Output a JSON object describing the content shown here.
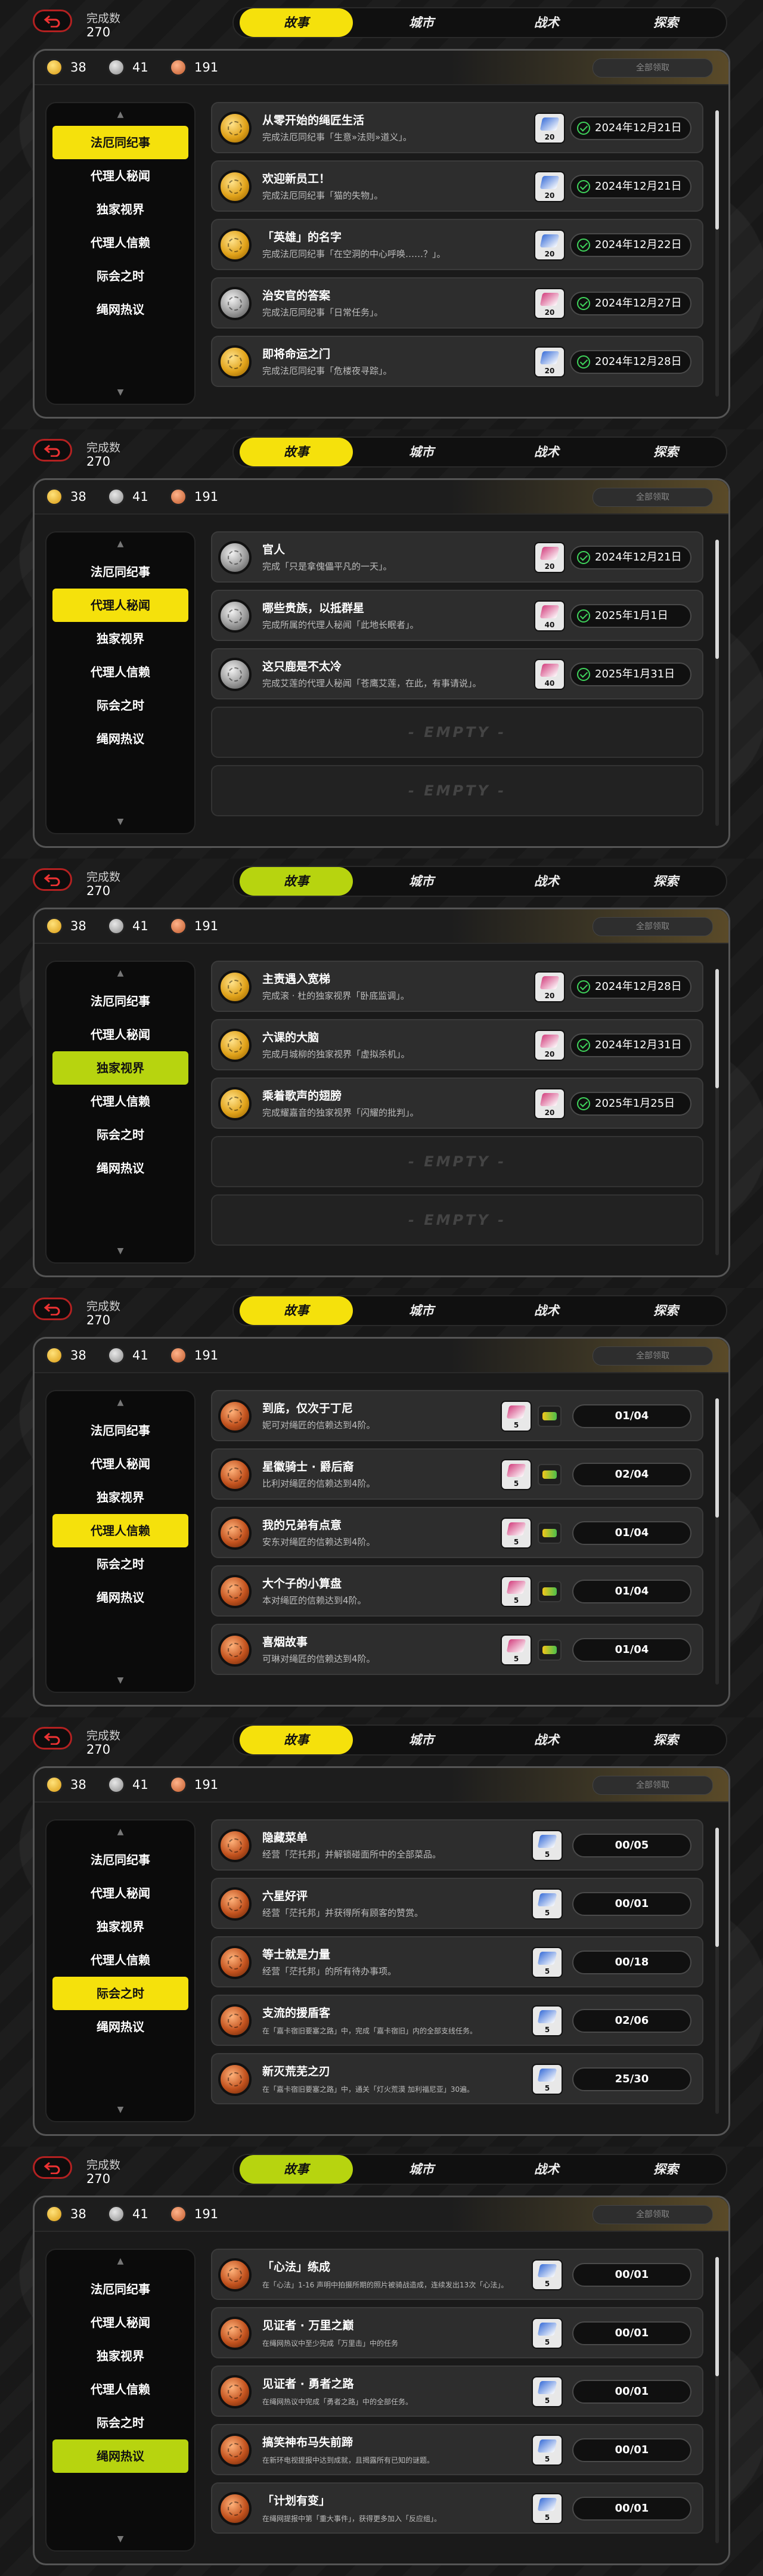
{
  "header": {
    "done_label": "完成数",
    "done_count": "270",
    "tabs": [
      "故事",
      "城市",
      "战术",
      "探索"
    ]
  },
  "currency": {
    "gold": "38",
    "silver": "41",
    "copper": "191"
  },
  "claim_all_label": "全部领取",
  "sidebar_items": [
    "法厄同纪事",
    "代理人秘闻",
    "独家视界",
    "代理人信赖",
    "际会之时",
    "绳网热议"
  ],
  "empty_label": "- EMPTY -",
  "colors": {
    "accent": "#f5e10c",
    "accent_variant": "#b7d40f",
    "check": "#3fd35b",
    "frame": "#555555"
  },
  "panels": [
    {
      "tab_accent": "#f5e10c",
      "active_side": 0,
      "rows": [
        {
          "medal": "gold",
          "title": "从零开始的绳匠生活",
          "desc": "完成法厄同纪事「生意»法则»道义」。",
          "reward_color": "#3b6fd8",
          "qty": "20",
          "kind": "date",
          "value": "2024年12月21日"
        },
        {
          "medal": "gold",
          "title": "欢迎新员工！",
          "desc": "完成法厄同纪事「猫的失物」。",
          "reward_color": "#3b6fd8",
          "qty": "20",
          "kind": "date",
          "value": "2024年12月21日"
        },
        {
          "medal": "gold",
          "title": "「英雄」的名字",
          "desc": "完成法厄同纪事「在空洞的中心呼唤……？」。",
          "reward_color": "#3b6fd8",
          "qty": "20",
          "kind": "date",
          "value": "2024年12月22日"
        },
        {
          "medal": "silver",
          "title": "治安官的答案",
          "desc": "完成法厄同纪事「日常任务」。",
          "reward_color": "#d3417f",
          "qty": "20",
          "kind": "date",
          "value": "2024年12月27日"
        },
        {
          "medal": "gold",
          "title": "即将命运之门",
          "desc": "完成法厄同纪事「危楼夜寻踪」。",
          "reward_color": "#3b6fd8",
          "qty": "20",
          "kind": "date",
          "value": "2024年12月28日"
        }
      ]
    },
    {
      "tab_accent": "#f5e10c",
      "active_side": 1,
      "rows": [
        {
          "medal": "silver",
          "title": "官人",
          "desc": "完成「只是拿傀儡平凡的一天」。",
          "reward_color": "#d3417f",
          "qty": "20",
          "kind": "date",
          "value": "2024年12月21日"
        },
        {
          "medal": "silver",
          "title": "哪些贵族，以抵群星",
          "desc": "完成所属的代理人秘闻「此地长眠者」。",
          "reward_color": "#d3417f",
          "qty": "40",
          "kind": "date",
          "value": "2025年1月1日"
        },
        {
          "medal": "silver",
          "title": "这只鹿是不太冷",
          "desc": "完成艾莲的代理人秘闻「苍鹰艾莲，在此，有事请说」。",
          "reward_color": "#d3417f",
          "qty": "40",
          "kind": "date",
          "value": "2025年1月31日"
        },
        {
          "empty": true
        },
        {
          "empty": true
        }
      ]
    },
    {
      "tab_accent": "#b7d40f",
      "active_side": 2,
      "rows": [
        {
          "medal": "gold",
          "title": "主责遇入宽梯",
          "desc": "完成滚 · 杜的独家视界「卧底监调」。",
          "reward_color": "#d3417f",
          "qty": "20",
          "kind": "date",
          "value": "2024年12月28日"
        },
        {
          "medal": "gold",
          "title": "六课的大脑",
          "desc": "完成月城柳的独家视界「虚拟杀机」。",
          "reward_color": "#d3417f",
          "qty": "20",
          "kind": "date",
          "value": "2024年12月31日"
        },
        {
          "medal": "gold",
          "title": "乘着歌声的翅膀",
          "desc": "完成耀嘉音的独家视界「闪耀的批判」。",
          "reward_color": "#d3417f",
          "qty": "20",
          "kind": "date",
          "value": "2025年1月25日"
        },
        {
          "empty": true
        },
        {
          "empty": true
        }
      ]
    },
    {
      "tab_accent": "#f5e10c",
      "active_side": 3,
      "rows": [
        {
          "medal": "bronze",
          "title": "到底，仅次于丁尼",
          "desc": "妮可对绳匠的信赖达到4阶。",
          "reward_color": "#d3417f",
          "qty": "5",
          "kind": "prog2",
          "value": "01/04"
        },
        {
          "medal": "bronze",
          "title": "星徽骑士 · 爵后裔",
          "desc": "比利对绳匠的信赖达到4阶。",
          "reward_color": "#d3417f",
          "qty": "5",
          "kind": "prog2",
          "value": "02/04"
        },
        {
          "medal": "bronze",
          "title": "我的兄弟有点意",
          "desc": "安东对绳匠的信赖达到4阶。",
          "reward_color": "#d3417f",
          "qty": "5",
          "kind": "prog2",
          "value": "01/04"
        },
        {
          "medal": "bronze",
          "title": "大个子的小算盘",
          "desc": "本对绳匠的信赖达到4阶。",
          "reward_color": "#d3417f",
          "qty": "5",
          "kind": "prog2",
          "value": "01/04"
        },
        {
          "medal": "bronze",
          "title": "喜烟故事",
          "desc": "可琳对绳匠的信赖达到4阶。",
          "reward_color": "#d3417f",
          "qty": "5",
          "kind": "prog2",
          "value": "01/04"
        }
      ]
    },
    {
      "tab_accent": "#f5e10c",
      "active_side": 4,
      "rows": [
        {
          "medal": "bronze",
          "title": "隐藏菜单",
          "desc": "经营「茫托邦」并解锁碰面所中的全部菜品。",
          "reward_color": "#3b6fd8",
          "qty": "5",
          "kind": "prog",
          "value": "00/05"
        },
        {
          "medal": "bronze",
          "title": "六星好评",
          "desc": "经营「茫托邦」并获得所有顾客的赞赏。",
          "reward_color": "#3b6fd8",
          "qty": "5",
          "kind": "prog",
          "value": "00/01"
        },
        {
          "medal": "bronze",
          "title": "等士就是力量",
          "desc": "经营「茫托邦」的所有待办事项。",
          "reward_color": "#3b6fd8",
          "qty": "5",
          "kind": "prog",
          "value": "00/18"
        },
        {
          "medal": "bronze",
          "title": "支流的援盾客",
          "desc": "在「嘉卡宿旧要塞之路」中，完成「嘉卡宿旧」内的全部支线任务。",
          "reward_color": "#3b6fd8",
          "qty": "5",
          "kind": "prog",
          "value": "02/06",
          "small": true
        },
        {
          "medal": "bronze",
          "title": "新灭荒芜之刃",
          "desc": "在「嘉卡宿旧要塞之路」中，通关「灯火荒漠 加利福尼亚」30遍。",
          "reward_color": "#3b6fd8",
          "qty": "5",
          "kind": "prog",
          "value": "25/30",
          "small": true
        }
      ]
    },
    {
      "tab_accent": "#b7d40f",
      "active_side": 5,
      "rows": [
        {
          "medal": "bronze",
          "title": "「心法」练成",
          "desc": "在「心法」1-16 声明中拍摄所期的照片被骑战造成，连续发出13次「心法」。",
          "reward_color": "#3b6fd8",
          "qty": "5",
          "kind": "prog",
          "value": "00/01",
          "small": true
        },
        {
          "medal": "bronze",
          "title": "见证者 · 万里之巅",
          "desc": "在绳网热议中至少完成「万里击」中的任务",
          "reward_color": "#3b6fd8",
          "qty": "5",
          "kind": "prog",
          "value": "00/01",
          "small": true
        },
        {
          "medal": "bronze",
          "title": "见证者 · 勇者之路",
          "desc": "在绳网热议中完成「勇者之路」中的全部任务。",
          "reward_color": "#3b6fd8",
          "qty": "5",
          "kind": "prog",
          "value": "00/01",
          "small": true
        },
        {
          "medal": "bronze",
          "title": "搞笑神布马失前蹄",
          "desc": "在新环电视提报中达到成就，且揭露所有已知的谜题。",
          "reward_color": "#3b6fd8",
          "qty": "5",
          "kind": "prog",
          "value": "00/01",
          "small": true
        },
        {
          "medal": "bronze",
          "title": "「计划有变」",
          "desc": "在绳网提报中第「重大事件」，获得更多加入「反应组」。",
          "reward_color": "#3b6fd8",
          "qty": "5",
          "kind": "prog",
          "value": "00/01",
          "small": true
        }
      ]
    }
  ]
}
